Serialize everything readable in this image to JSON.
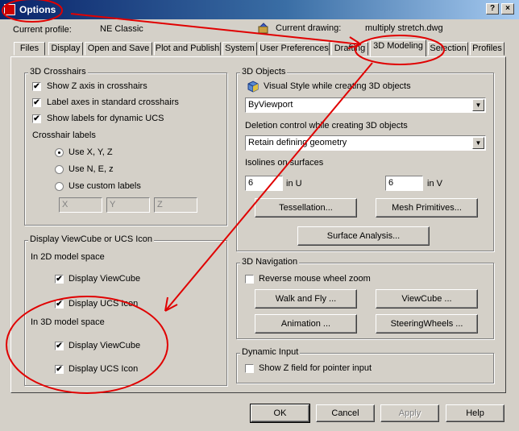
{
  "window": {
    "title": "Options",
    "close_glyph": "×",
    "help_glyph": "?"
  },
  "profile": {
    "label": "Current profile:",
    "value": "NE Classic"
  },
  "drawing": {
    "label": "Current drawing:",
    "value": "multiply stretch.dwg"
  },
  "tabs": [
    {
      "label": "Files"
    },
    {
      "label": "Display"
    },
    {
      "label": "Open and Save"
    },
    {
      "label": "Plot and Publish"
    },
    {
      "label": "System"
    },
    {
      "label": "User Preferences"
    },
    {
      "label": "Drafting"
    },
    {
      "label": "3D Modeling"
    },
    {
      "label": "Selection"
    },
    {
      "label": "Profiles"
    }
  ],
  "crosshairs": {
    "title": "3D Crosshairs",
    "items": [
      {
        "label": "Show Z axis in crosshairs",
        "checked": true
      },
      {
        "label": "Label axes in standard crosshairs",
        "checked": true
      },
      {
        "label": "Show labels for dynamic UCS",
        "checked": true
      }
    ],
    "labels_title": "Crosshair labels",
    "radios": [
      {
        "label": "Use X, Y, Z",
        "selected": true
      },
      {
        "label": "Use N, E, z",
        "selected": false
      },
      {
        "label": "Use custom labels",
        "selected": false
      }
    ],
    "custom": [
      "X",
      "Y",
      "Z"
    ]
  },
  "viewcube": {
    "title": "Display ViewCube or UCS Icon",
    "space2d": "In 2D model space",
    "space3d": "In 3D model space",
    "items2d": [
      {
        "label": "Display ViewCube",
        "checked": true
      },
      {
        "label": "Display UCS Icon",
        "checked": true
      }
    ],
    "items3d": [
      {
        "label": "Display ViewCube",
        "checked": true
      },
      {
        "label": "Display UCS Icon",
        "checked": true
      }
    ]
  },
  "objects": {
    "title": "3D Objects",
    "visual_style_label": "Visual Style while creating 3D objects",
    "visual_style_value": "ByViewport",
    "deletion_label": "Deletion control while creating 3D objects",
    "deletion_value": "Retain defining geometry",
    "isolines_label": "Isolines on surfaces",
    "u_value": "6",
    "u_label": "in U",
    "v_value": "6",
    "v_label": "in V",
    "tessellation_btn": "Tessellation...",
    "mesh_btn": "Mesh Primitives...",
    "surface_btn": "Surface Analysis..."
  },
  "navigation": {
    "title": "3D Navigation",
    "reverse_label": "Reverse mouse wheel zoom",
    "reverse_checked": false,
    "walk_btn": "Walk and Fly ...",
    "viewcube_btn": "ViewCube ...",
    "animation_btn": "Animation ...",
    "steering_btn": "SteeringWheels ..."
  },
  "dynamic": {
    "title": "Dynamic Input",
    "showz_label": "Show Z field for pointer input",
    "showz_checked": false
  },
  "footer": {
    "ok": "OK",
    "cancel": "Cancel",
    "apply": "Apply",
    "help": "Help"
  },
  "annotation_color": "#e00000",
  "check_glyph": "✔",
  "dropdown_glyph": "▼"
}
